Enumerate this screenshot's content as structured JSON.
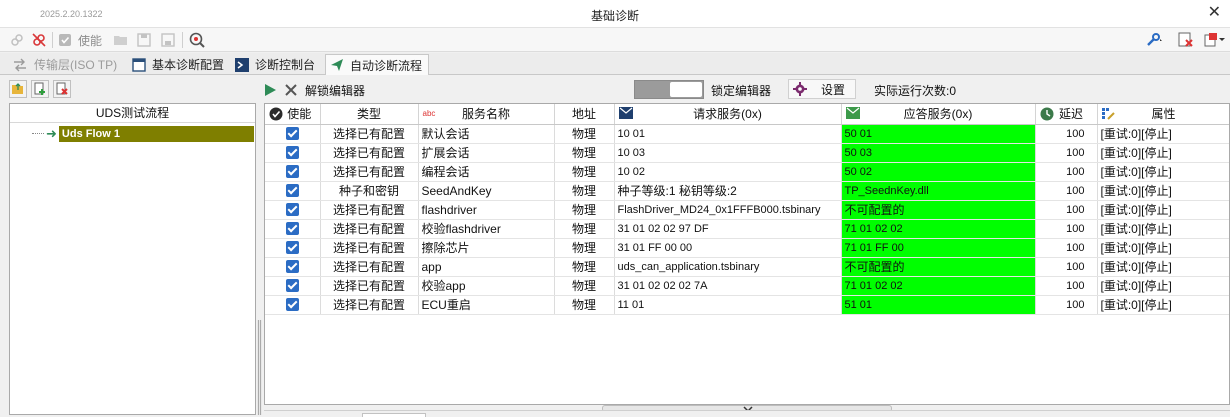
{
  "window": {
    "version": "2025.2.20.1322",
    "title": "基础诊断"
  },
  "toolbar": {
    "enable_label": "使能"
  },
  "tabs": [
    {
      "label": "传输层(ISO TP)",
      "icon": "transport-icon"
    },
    {
      "label": "基本诊断配置",
      "icon": "config-icon"
    },
    {
      "label": "诊断控制台",
      "icon": "console-icon"
    },
    {
      "label": "自动诊断流程",
      "icon": "send-icon"
    }
  ],
  "left_panel": {
    "header": "UDS测试流程",
    "items": [
      {
        "label": "Uds Flow 1"
      }
    ]
  },
  "flow_toolbar": {
    "unlock_label": "解锁编辑器",
    "lock_label": "锁定编辑器",
    "settings_label": "设置",
    "run_count": "实际运行次数:0"
  },
  "table": {
    "headers": {
      "enable": "使能",
      "type": "类型",
      "name_prefix": "abc",
      "name": "服务名称",
      "addr": "地址",
      "request": "请求服务(0x)",
      "response": "应答服务(0x)",
      "delay": "延迟",
      "attr": "属性"
    },
    "rows": [
      {
        "type": "选择已有配置",
        "name": "默认会话",
        "addr": "物理",
        "request": "10 01",
        "response": "50 01",
        "delay": "100",
        "attr": "[重试:0][停止]"
      },
      {
        "type": "选择已有配置",
        "name": "扩展会话",
        "addr": "物理",
        "request": "10 03",
        "response": "50 03",
        "delay": "100",
        "attr": "[重试:0][停止]"
      },
      {
        "type": "选择已有配置",
        "name": "编程会话",
        "addr": "物理",
        "request": "10 02",
        "response": "50 02",
        "delay": "100",
        "attr": "[重试:0][停止]"
      },
      {
        "type": "种子和密钥",
        "name": "SeedAndKey",
        "addr": "物理",
        "request": "种子等级:1 秘钥等级:2",
        "response": "TP_SeednKey.dll",
        "delay": "100",
        "attr": "[重试:0][停止]"
      },
      {
        "type": "选择已有配置",
        "name": "flashdriver",
        "addr": "物理",
        "request": "FlashDriver_MD24_0x1FFFB000.tsbinary",
        "response": "不可配置的",
        "delay": "100",
        "attr": "[重试:0][停止]"
      },
      {
        "type": "选择已有配置",
        "name": "校验flashdriver",
        "addr": "物理",
        "request": "31 01 02 02 97 DF",
        "response": "71 01 02 02",
        "delay": "100",
        "attr": "[重试:0][停止]"
      },
      {
        "type": "选择已有配置",
        "name": "擦除芯片",
        "addr": "物理",
        "request": "31 01 FF 00 00",
        "response": "71 01 FF 00",
        "delay": "100",
        "attr": "[重试:0][停止]"
      },
      {
        "type": "选择已有配置",
        "name": "app",
        "addr": "物理",
        "request": "uds_can_application.tsbinary",
        "response": "不可配置的",
        "delay": "100",
        "attr": "[重试:0][停止]"
      },
      {
        "type": "选择已有配置",
        "name": "校验app",
        "addr": "物理",
        "request": "31 01 02 02 02 7A",
        "response": "71 01 02 02",
        "delay": "100",
        "attr": "[重试:0][停止]"
      },
      {
        "type": "选择已有配置",
        "name": "ECU重启",
        "addr": "物理",
        "request": "11 01",
        "response": "51 01",
        "delay": "100",
        "attr": "[重试:0][停止]"
      }
    ]
  },
  "colors": {
    "response_bg": "#00ff00",
    "selected_tree": "#7f7f00",
    "checkbox": "#2b6cc4"
  }
}
